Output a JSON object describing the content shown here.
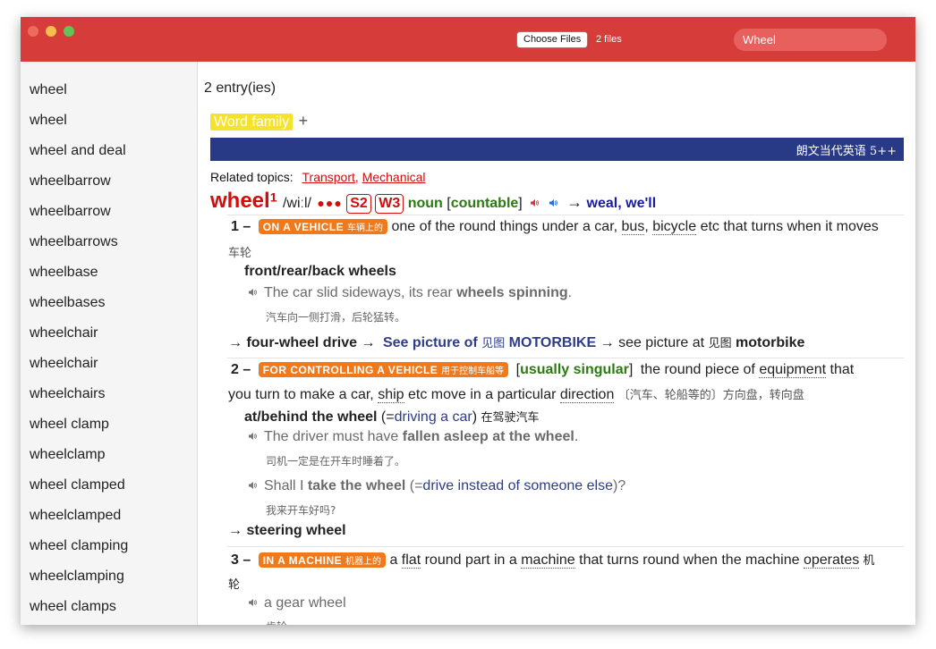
{
  "window": {
    "choose_files_label": "Choose Files",
    "files_count": "2 files",
    "search_value": "Wheel"
  },
  "sidebar": {
    "items": [
      "wheel",
      "wheel",
      "wheel and deal",
      "wheelbarrow",
      "wheelbarrow",
      "wheelbarrows",
      "wheelbase",
      "wheelbases",
      "wheelchair",
      "wheelchair",
      "wheelchairs",
      "wheel clamp",
      "wheelclamp",
      "wheel clamped",
      "wheelclamped",
      "wheel clamping",
      "wheelclamping",
      "wheel clamps"
    ]
  },
  "main": {
    "entry_count": "2 entry(ies)",
    "word_family_label": "Word family",
    "expand_symbol": "+",
    "dictionary_name": "朗文当代英语 5++",
    "related_topics_label": "Related topics:",
    "topics": [
      "Transport",
      "Mechanical"
    ],
    "headword": "wheel",
    "homonym": "1",
    "pronunciation": "/wiːl/",
    "frequency_dots": "●●●",
    "spoken_freq": "S2",
    "written_freq": "W3",
    "pos": "noun",
    "grammar": "countable",
    "arrow": "→",
    "homophones": [
      "weal",
      "we'll"
    ],
    "senses": [
      {
        "num": "1 –",
        "signpost": "ON A VEHICLE",
        "signpost_zh": "车辆上的",
        "definition_parts": [
          "one of the round things under a car, ",
          "bus",
          ", ",
          "bicycle",
          " etc that turns when it moves"
        ],
        "definition_zh": "车轮",
        "collocation": "front/rear/back wheels",
        "example_parts": [
          "The car slid sideways, its rear ",
          "wheels spinning",
          "."
        ],
        "example_zh": "汽车向一侧打滑，后轮猛转。",
        "crossref_a": "four-wheel drive",
        "crossref_b_pre": "See picture of",
        "crossref_b_zh": "见图",
        "crossref_b_word": "MOTORBIKE",
        "crossref_c_pre": "see picture at",
        "crossref_c_zh": "见图",
        "crossref_c_word": "motorbike"
      },
      {
        "num": "2 –",
        "signpost": "FOR CONTROLLING A VEHICLE",
        "signpost_zh": "用于控制车船等",
        "grammar": "usually singular",
        "definition_l1_parts": [
          "the round piece of ",
          "equipment",
          " that"
        ],
        "definition_l2_parts": [
          "you turn to make a car, ",
          "ship",
          " etc move in a particular ",
          "direction"
        ],
        "definition_zh": "〔汽车、轮船等的〕方向盘，转向盘",
        "phrase": "at/behind the wheel",
        "phrase_gloss": "driving a car",
        "phrase_zh": "在驾驶汽车",
        "example1_parts": [
          "The driver must have ",
          "fallen asleep at the wheel",
          "."
        ],
        "example1_zh": "司机一定是在开车时睡着了。",
        "example2_parts": [
          "Shall I ",
          "take the wheel",
          " (=",
          "drive instead of someone else",
          ")?"
        ],
        "example2_zh": "我来开车好吗?",
        "crossref": "steering wheel"
      },
      {
        "num": "3 –",
        "signpost": "IN A MACHINE",
        "signpost_zh": "机器上的",
        "definition_parts": [
          "a ",
          "flat",
          " round part in a ",
          "machine",
          " that turns round when the machine ",
          "operates",
          " 机"
        ],
        "definition_zh_l2": "轮",
        "example": "a gear wheel",
        "example_zh": "齿轮"
      }
    ]
  },
  "colors": {
    "titlebar": "#d53c3a",
    "banner": "#283a86",
    "headword": "#d10d0d",
    "signpost": "#f07a1b",
    "word_family": "#f5e22c"
  }
}
